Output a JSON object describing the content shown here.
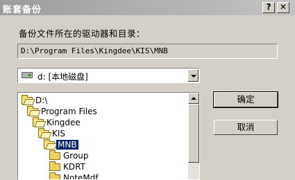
{
  "window": {
    "title": "账套备份",
    "help_glyph": "?",
    "close_glyph": "✕"
  },
  "prompt_label": "备份文件所在的驱动器和目录：",
  "path_value": "D:\\Program Files\\Kingdee\\KIS\\MNB",
  "drive": {
    "selected": "d: [本地磁盘]",
    "icon": "hard-drive-icon"
  },
  "folder_tree": [
    {
      "label": "D:\\",
      "open": true,
      "selected": false
    },
    {
      "label": "Program Files",
      "open": true,
      "selected": false
    },
    {
      "label": "Kingdee",
      "open": true,
      "selected": false
    },
    {
      "label": "KIS",
      "open": true,
      "selected": false
    },
    {
      "label": "MNB",
      "open": true,
      "selected": true
    },
    {
      "label": "Group",
      "open": false,
      "selected": false
    },
    {
      "label": "KDRT",
      "open": false,
      "selected": false
    },
    {
      "label": "NoteMdf",
      "open": false,
      "selected": false
    }
  ],
  "buttons": {
    "ok": "确定",
    "cancel": "取消"
  }
}
